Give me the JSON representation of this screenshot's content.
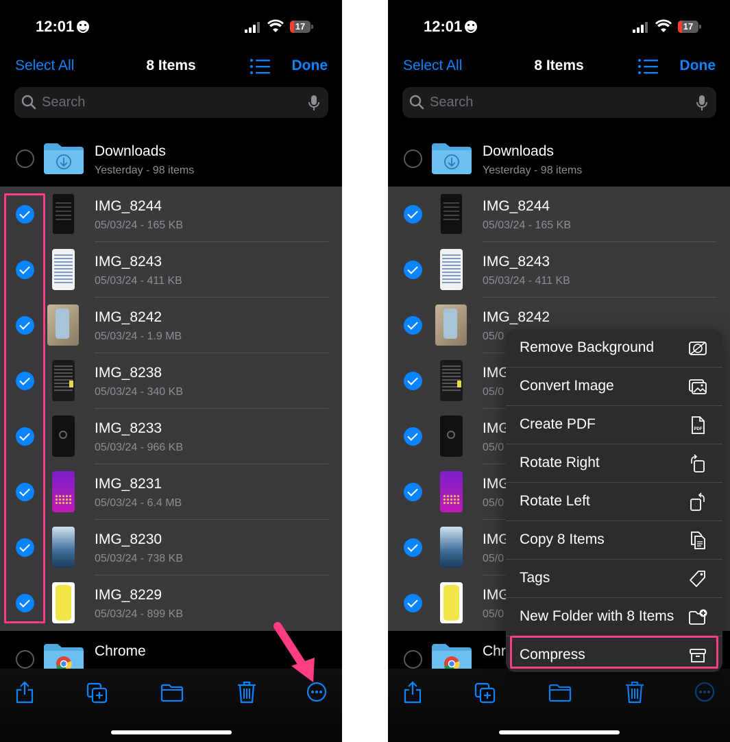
{
  "status": {
    "time": "12:01",
    "battery": "17"
  },
  "nav": {
    "select_all": "Select All",
    "title": "8 Items",
    "done": "Done"
  },
  "search": {
    "placeholder": "Search"
  },
  "downloads": {
    "name": "Downloads",
    "meta": "Yesterday - 98 items"
  },
  "files": [
    {
      "name": "IMG_8244",
      "meta": "05/03/24 - 165 KB"
    },
    {
      "name": "IMG_8243",
      "meta": "05/03/24 - 411 KB"
    },
    {
      "name": "IMG_8242",
      "meta": "05/03/24 - 1.9 MB"
    },
    {
      "name": "IMG_8238",
      "meta": "05/03/24 - 340 KB"
    },
    {
      "name": "IMG_8233",
      "meta": "05/03/24 - 966 KB"
    },
    {
      "name": "IMG_8231",
      "meta": "05/03/24 - 6.4 MB"
    },
    {
      "name": "IMG_8230",
      "meta": "05/03/24 - 738 KB"
    },
    {
      "name": "IMG_8229",
      "meta": "05/03/24 - 899 KB"
    }
  ],
  "chrome": {
    "name": "Chrome",
    "name_truncated": "Chr"
  },
  "right_partial": {
    "img_8242_meta": "05/0",
    "names": [
      "IMG",
      "IMG",
      "IMG",
      "IMG",
      "IMG"
    ],
    "metas": [
      "05/0",
      "05/0",
      "05/0",
      "05/0",
      "05/0"
    ]
  },
  "menu": {
    "items": [
      {
        "label": "Remove Background",
        "icon": "remove-background-icon"
      },
      {
        "label": "Convert Image",
        "icon": "convert-image-icon"
      },
      {
        "label": "Create PDF",
        "icon": "pdf-document-icon"
      },
      {
        "label": "Rotate Right",
        "icon": "rotate-right-icon"
      },
      {
        "label": "Rotate Left",
        "icon": "rotate-left-icon"
      },
      {
        "label": "Copy 8 Items",
        "icon": "copy-documents-icon"
      },
      {
        "label": "Tags",
        "icon": "tag-icon"
      },
      {
        "label": "New Folder with 8 Items",
        "icon": "folder-plus-icon"
      },
      {
        "label": "Compress",
        "icon": "archive-box-icon"
      }
    ]
  },
  "toolbar_icons": [
    "share-icon",
    "duplicate-icon",
    "move-folder-icon",
    "trash-icon",
    "more-ellipsis-icon"
  ],
  "colors": {
    "accent": "#0a84ff",
    "highlight": "#ff3d84",
    "selected_row": "#3a3a3c",
    "menu_bg": "#2c2c2e"
  }
}
